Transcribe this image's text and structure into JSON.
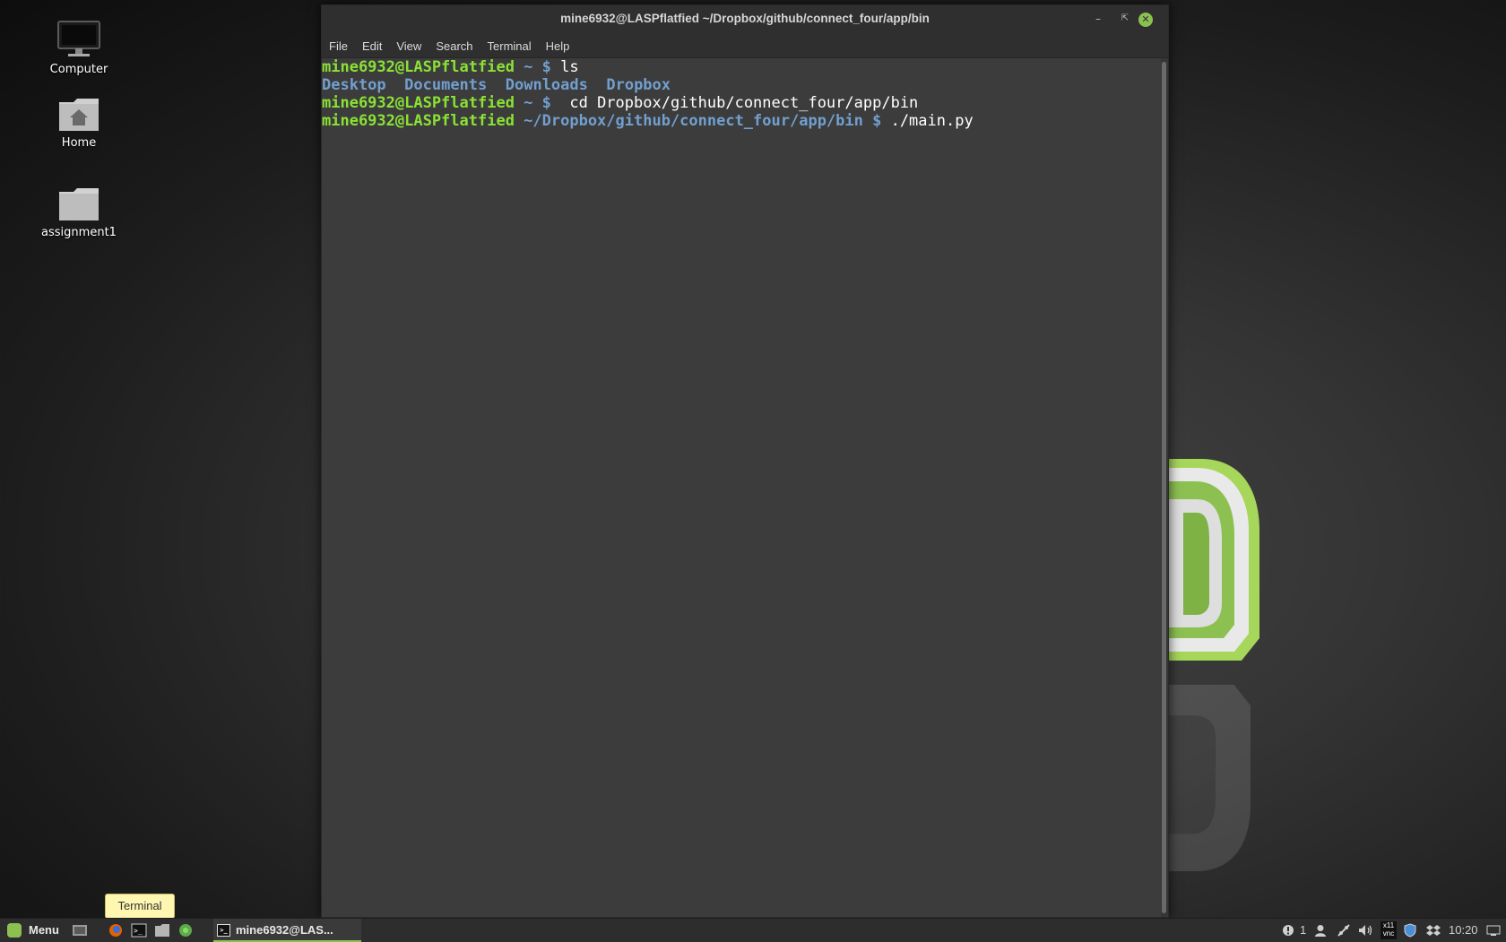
{
  "desktop": {
    "icons": [
      {
        "label": "Computer"
      },
      {
        "label": "Home"
      },
      {
        "label": "assignment1"
      }
    ]
  },
  "terminal": {
    "title": "mine6932@LASPflatfied ~/Dropbox/github/connect_four/app/bin",
    "menu": [
      "File",
      "Edit",
      "View",
      "Search",
      "Terminal",
      "Help"
    ],
    "lines": [
      {
        "prompt": "mine6932@LASPflatfied",
        "path": " ~ $",
        "cmd": " ls"
      },
      {
        "dirs": [
          "Desktop",
          "Documents",
          "Downloads",
          "Dropbox"
        ]
      },
      {
        "prompt": "mine6932@LASPflatfied",
        "path": " ~ $",
        "cmd": "  cd Dropbox/github/connect_four/app/bin"
      },
      {
        "prompt": "mine6932@LASPflatfied",
        "path": " ~/Dropbox/github/connect_four/app/bin $",
        "cmd": " ./main.py"
      }
    ]
  },
  "tooltip": "Terminal",
  "taskbar": {
    "menu_label": "Menu",
    "task_label": "mine6932@LAS...",
    "notifications_count": "1",
    "vnc_label_top": "x11",
    "vnc_label_bottom": "vnc",
    "clock": "10:20"
  },
  "colors": {
    "accent": "#8cc152",
    "prompt": "#8ae234",
    "directory": "#729fcf"
  }
}
